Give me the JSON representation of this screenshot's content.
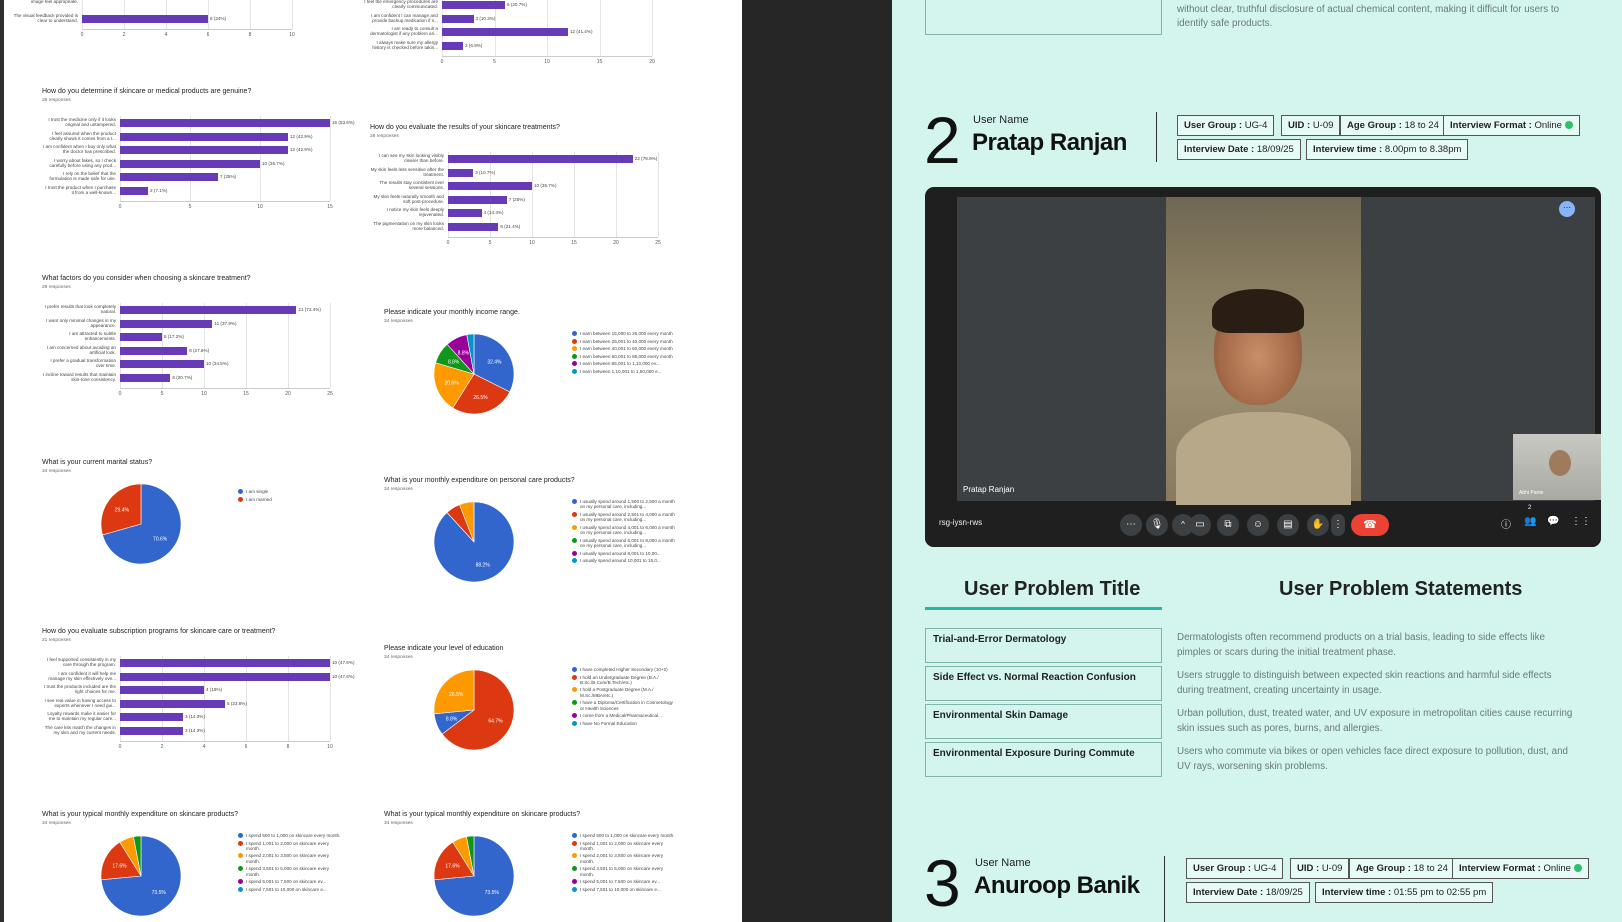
{
  "survey": {
    "charts": [
      {
        "id": "c0",
        "type": "bar",
        "title": "",
        "responses": "",
        "bars": [
          {
            "label": "image feel appropriate.",
            "value": null,
            "value_label": ""
          },
          {
            "label": "The visual feedback provided is clear to understand.",
            "value": 6,
            "value_label": "6 (24%)"
          }
        ],
        "ticks": [
          0,
          2,
          4,
          6,
          8,
          10
        ],
        "max": 10
      },
      {
        "id": "c1",
        "type": "bar",
        "title": "",
        "responses": "",
        "bars": [
          {
            "label": "I feel the emergency procedures are clearly communicated.",
            "value": 6,
            "value_label": "6 (20.7%)"
          },
          {
            "label": "I am confident I can manage and provide backup medication if n...",
            "value": 3,
            "value_label": "3 (10.3%)"
          },
          {
            "label": "I am ready to consult a dermatologist if any problem ari...",
            "value": 12,
            "value_label": "12 (41.4%)"
          },
          {
            "label": "I always make sure my allergy history is checked before takin...",
            "value": 2,
            "value_label": "2 (6.9%)"
          }
        ],
        "ticks": [
          0,
          5,
          10,
          15,
          20
        ],
        "max": 20
      },
      {
        "id": "c2",
        "type": "bar",
        "title": "How do you determine if skincare or medical products are genuine?",
        "responses": "28 responses",
        "bars": [
          {
            "label": "I trust the medicine only if it looks original and untampered.",
            "value": 15,
            "value_label": "15 (53.6%)"
          },
          {
            "label": "I feel assured when the product clearly shows it comes from a t...",
            "value": 12,
            "value_label": "12 (42.9%)"
          },
          {
            "label": "I am confident when I buy only what the doctor has prescribed.",
            "value": 12,
            "value_label": "12 (42.9%)"
          },
          {
            "label": "I worry about fakes, so I check carefully before using any prod...",
            "value": 10,
            "value_label": "10 (35.7%)"
          },
          {
            "label": "I rely on the belief that the formulation is made safe for use.",
            "value": 7,
            "value_label": "7 (25%)"
          },
          {
            "label": "I trust the product when I purchase it from a well-known...",
            "value": 2,
            "value_label": "2 (7.1%)"
          }
        ],
        "ticks": [
          0,
          5,
          10,
          15
        ],
        "max": 15
      },
      {
        "id": "c3",
        "type": "bar",
        "title": "How do you evaluate the results of your skincare treatments?",
        "responses": "28 responses",
        "bars": [
          {
            "label": "I can see my skin looking visibly clearer than before.",
            "value": 22,
            "value_label": "22 (78.6%)"
          },
          {
            "label": "My skin feels less sensitive after the treatment.",
            "value": 3,
            "value_label": "3 (10.7%)"
          },
          {
            "label": "The results stay consistent over several sessions.",
            "value": 10,
            "value_label": "10 (35.7%)"
          },
          {
            "label": "My skin feels naturally smooth and soft post-procedure.",
            "value": 7,
            "value_label": "7 (25%)"
          },
          {
            "label": "I notice my skin feels deeply rejuvenated.",
            "value": 4,
            "value_label": "4 (14.3%)"
          },
          {
            "label": "The pigmentation on my skin looks more balanced.",
            "value": 6,
            "value_label": "6 (21.4%)"
          }
        ],
        "ticks": [
          0,
          5,
          10,
          15,
          20,
          25
        ],
        "max": 25
      },
      {
        "id": "c4",
        "type": "bar",
        "title": "What factors do you consider when choosing a skincare treatment?",
        "responses": "29 responses",
        "bars": [
          {
            "label": "I prefer results that look completely natural.",
            "value": 21,
            "value_label": "21 (72.4%)"
          },
          {
            "label": "I want only minimal changes in my appearance.",
            "value": 11,
            "value_label": "11 (37.9%)"
          },
          {
            "label": "I am attracted to subtle enhancements.",
            "value": 5,
            "value_label": "5 (17.2%)"
          },
          {
            "label": "I am concerned about avoiding an artificial look.",
            "value": 8,
            "value_label": "8 (27.6%)"
          },
          {
            "label": "I prefer a gradual transformation over time.",
            "value": 10,
            "value_label": "10 (34.5%)"
          },
          {
            "label": "I incline toward results that maintain skin-tone consistency.",
            "value": 6,
            "value_label": "6 (20.7%)"
          }
        ],
        "ticks": [
          0,
          5,
          10,
          15,
          20,
          25
        ],
        "max": 25
      },
      {
        "id": "c5",
        "type": "bar",
        "title": "How do you evaluate subscription programs for skincare care or treatment?",
        "responses": "21 responses",
        "bars": [
          {
            "label": "I feel supported consistently in my care through the program.",
            "value": 10,
            "value_label": "10 (47.6%)"
          },
          {
            "label": "I am confident it will help me manage my skin effectively ove...",
            "value": 10,
            "value_label": "10 (47.6%)"
          },
          {
            "label": "I trust the products included are the right choices for me.",
            "value": 4,
            "value_label": "4 (19%)"
          },
          {
            "label": "I see real value in having access to experts whenever I need gui...",
            "value": 5,
            "value_label": "5 (23.8%)"
          },
          {
            "label": "Loyalty rewards make it easier for me to maintain my regular care...",
            "value": 3,
            "value_label": "3 (14.3%)"
          },
          {
            "label": "The care kits match the changes in my skin and my current needs.",
            "value": 3,
            "value_label": "3 (14.3%)"
          }
        ],
        "ticks": [
          0,
          2,
          4,
          6,
          8,
          10
        ],
        "max": 10
      }
    ],
    "pies": [
      {
        "id": "p0",
        "title": "Please indicate your monthly income range.",
        "responses": "34 responses",
        "slices": [
          {
            "value": 32.4,
            "color": "#3366cc",
            "label": "32.4%"
          },
          {
            "value": 26.5,
            "color": "#dc3912",
            "label": "26.5%"
          },
          {
            "value": 20.6,
            "color": "#ff9900",
            "label": "20.6%"
          },
          {
            "value": 8.8,
            "color": "#109618",
            "label": "8.8%"
          },
          {
            "value": 8.8,
            "color": "#990099",
            "label": "8.8%"
          },
          {
            "value": 2.9,
            "color": "#0099c6",
            "label": ""
          }
        ],
        "legend": [
          "I earn between 15,000 to 25,000 every month",
          "I earn between 25,001 to 40,000 every month",
          "I earn between 40,001 to 60,000 every month",
          "I earn between 60,001 to 85,000 every month",
          "I earn between 85,001 to 1,10,000 ev...",
          "I earn between 1,10,001 to 1,50,000 e..."
        ]
      },
      {
        "id": "p1",
        "title": "What is your current marital status?",
        "responses": "34 responses",
        "slices": [
          {
            "value": 70.6,
            "color": "#3366cc",
            "label": "70.6%"
          },
          {
            "value": 29.4,
            "color": "#dc3912",
            "label": "29.4%"
          }
        ],
        "legend": [
          "I am single",
          "I am married"
        ]
      },
      {
        "id": "p2",
        "title": "What is your monthly expenditure on personal care products?",
        "responses": "34 responses",
        "slices": [
          {
            "value": 88.2,
            "color": "#3366cc",
            "label": "88.2%"
          },
          {
            "value": 5.9,
            "color": "#dc3912",
            "label": ""
          },
          {
            "value": 5.9,
            "color": "#ff9900",
            "label": ""
          }
        ],
        "legend": [
          "I usually spend around 1,500 to 2,500 a month on my personal care, including...",
          "I usually spend around 2,501 to 4,000 a month on my personal care, including...",
          "I usually spend around 4,001 to 6,000 a month on my personal care, including...",
          "I usually spend around 6,001 to 8,000 a month on my personal care, including...",
          "I usually spend around 8,001 to 10,00...",
          "I usually spend around 10,001 to 15,0..."
        ]
      },
      {
        "id": "p3",
        "title": "Please indicate your level of education",
        "responses": "34 responses",
        "slices": [
          {
            "value": 64.7,
            "color": "#dc3912",
            "label": "64.7%"
          },
          {
            "value": 8.8,
            "color": "#3366cc",
            "label": "8.8%"
          },
          {
            "value": 26.5,
            "color": "#ff9900",
            "label": "26.5%"
          }
        ],
        "legend": [
          "I have completed Higher Secondary (10+2)",
          "I hold an Undergraduate Degree (B.A./ B.Sc./B.Com/B.Tech/etc.)",
          "I hold a Postgraduate Degree (M.A./ M.Sc./MBA/etc.)",
          "I have a Diploma/Certification in Cosmetology or Health Sciences",
          "I come from a Medical/Pharmaceutical...",
          "I have No Formal Education"
        ]
      },
      {
        "id": "p4",
        "title": "What is your typical monthly expenditure on skincare products?",
        "responses": "34 responses",
        "slices": [
          {
            "value": 73.5,
            "color": "#3366cc",
            "label": "73.5%"
          },
          {
            "value": 17.6,
            "color": "#dc3912",
            "label": "17.6%"
          },
          {
            "value": 5.9,
            "color": "#ff9900",
            "label": ""
          },
          {
            "value": 3.0,
            "color": "#109618",
            "label": ""
          }
        ],
        "legend": [
          "I spend 500 to 1,000 on skincare every month.",
          "I spend 1,001 to 2,000 on skincare every month.",
          "I spend 2,001 to 3,500 on skincare every month.",
          "I spend 3,501 to 5,000 on skincare every month.",
          "I spend 5,001 to 7,500 on skincare ev...",
          "I spend 7,501 to 10,000 on skincare e..."
        ]
      },
      {
        "id": "p5",
        "title": "What is your typical monthly expenditure on skincare products?",
        "responses": "34 responses",
        "slices": [
          {
            "value": 73.5,
            "color": "#3366cc",
            "label": "73.5%"
          },
          {
            "value": 17.6,
            "color": "#dc3912",
            "label": "17.6%"
          },
          {
            "value": 5.9,
            "color": "#ff9900",
            "label": ""
          },
          {
            "value": 3.0,
            "color": "#109618",
            "label": ""
          }
        ],
        "legend": [
          "I spend 500 to 1,000 on skincare every month.",
          "I spend 1,001 to 2,000 on skincare every month.",
          "I spend 2,001 to 3,500 on skincare every month.",
          "I spend 3,501 to 5,000 on skincare every month.",
          "I spend 5,001 to 7,500 on skincare ev...",
          "I spend 7,501 to 10,000 on skincare e..."
        ]
      }
    ],
    "legend_colors": [
      "#3366cc",
      "#dc3912",
      "#ff9900",
      "#109618",
      "#990099",
      "#0099c6"
    ]
  },
  "board": {
    "top_text": "without clear, truthful disclosure of actual chemical content, making it difficult for users to identify safe products.",
    "user2": {
      "number": "2",
      "name_label": "User Name",
      "name": "Pratap Ranjan",
      "group_k": "User Group :",
      "group_v": "UG-4",
      "uid_k": "UID :",
      "uid_v": "U-09",
      "age_k": "Age Group :",
      "age_v": "18 to 24",
      "format_k": "Interview Format :",
      "format_v": "Online",
      "date_k": "Interview Date :",
      "date_v": "18/09/25",
      "time_k": "Interview time :",
      "time_v": "8.00pm to 8.38pm"
    },
    "call": {
      "participant": "Pratap Ranjan",
      "self_name": "Abhi Pame",
      "meeting_code": "rsg-iysn-rws",
      "people_count": "2"
    },
    "problem_title_header": "User Problem Title",
    "problem_statements_header": "User Problem Statements",
    "problems": [
      {
        "title": "Trial-and-Error Dermatology",
        "statement": "Dermatologists often recommend products on a trial basis, leading to side effects like pimples or scars during the initial treatment phase."
      },
      {
        "title": "Side Effect vs. Normal Reaction Confusion",
        "statement": "Users struggle to distinguish between expected skin reactions and harmful side effects during treatment, creating uncertainty in usage."
      },
      {
        "title": "Environmental Skin Damage",
        "statement": "Urban pollution, dust, treated water, and UV exposure in metropolitan cities cause recurring skin issues such as pores, burns, and allergies."
      },
      {
        "title": "Environmental Exposure During Commute",
        "statement": "Users who commute via bikes or open vehicles face direct exposure to pollution, dust, and UV rays, worsening skin problems."
      }
    ],
    "user3": {
      "number": "3",
      "name_label": "User Name",
      "name": "Anuroop Banik",
      "group_k": "User Group :",
      "group_v": "UG-4",
      "uid_k": "UID :",
      "uid_v": "U-09",
      "age_k": "Age Group :",
      "age_v": "18 to 24",
      "format_k": "Interview Format :",
      "format_v": "Online",
      "date_k": "Interview Date :",
      "date_v": "18/09/25",
      "time_k": "Interview time :",
      "time_v": "01:55 pm to 02:55 pm"
    }
  }
}
